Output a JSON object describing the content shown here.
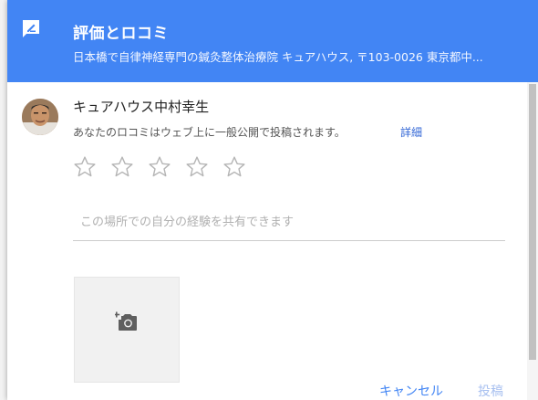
{
  "header": {
    "title": "評価とロコミ",
    "subtitle": "日本橋で自律神経専門の鍼灸整体治療院 キュアハウス, 〒103-0026 東京都中..."
  },
  "user": {
    "name": "キュアハウス中村幸生",
    "notice": "あなたのロコミはウェブ上に一般公開で投稿されます。",
    "details_label": "詳細"
  },
  "rating": {
    "max": 5,
    "value": 0
  },
  "review": {
    "placeholder": "この場所での自分の経験を共有できます",
    "value": ""
  },
  "photo": {
    "icon": "add-photo-camera-icon"
  },
  "actions": {
    "cancel_label": "キャンセル",
    "post_label": "投稿"
  },
  "colors": {
    "header": "#4285f4",
    "link": "#3367d6",
    "star_outline": "#b5b5b5"
  }
}
